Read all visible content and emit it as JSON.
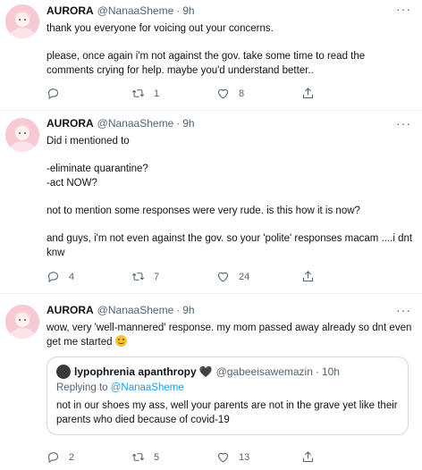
{
  "tweets": [
    {
      "name": "AURORA",
      "handle": "@NanaaSheme",
      "dot": "·",
      "time": "9h",
      "more": "···",
      "lines": [
        "thank you everyone for voicing out your concerns.",
        "please, once again i'm not against the gov. take some time to read the comments crying for help. maybe you'd understand better.."
      ],
      "replies": "",
      "retweets": "1",
      "likes": "8"
    },
    {
      "name": "AURORA",
      "handle": "@NanaaSheme",
      "dot": "·",
      "time": "9h",
      "more": "···",
      "lines": [
        "Did i mentioned to",
        "-eliminate quarantine?\n-act NOW?",
        "not to mention some responses were very rude. is this how it is now?",
        "and guys, i'm not even against the gov. so your 'polite' responses macam ....i dnt knw"
      ],
      "replies": "4",
      "retweets": "7",
      "likes": "24"
    },
    {
      "name": "AURORA",
      "handle": "@NanaaSheme",
      "dot": "·",
      "time": "9h",
      "more": "···",
      "text": "wow, very 'well-mannered' response. my mom passed away already so dnt even get me started",
      "emoji": "smiling-face-emoji",
      "quote": {
        "name": "lypophrenia apanthropy",
        "heart": "🖤",
        "handle": "@gabeeisawemazin",
        "dot": "·",
        "time": "10h",
        "replying_prefix": "Replying to",
        "replying_to": "@NanaaSheme",
        "text": "not in our shoes my ass, well your parents are not in the grave yet like their parents who died because of covid-19"
      },
      "replies": "2",
      "retweets": "5",
      "likes": "13"
    }
  ],
  "icons": {
    "reply": "reply-icon",
    "retweet": "retweet-icon",
    "like": "like-icon",
    "share": "share-icon"
  },
  "colors": {
    "accent": "#1d9bf0",
    "secondary_text": "#536471",
    "avatar_bg": "#f6c9d3"
  }
}
